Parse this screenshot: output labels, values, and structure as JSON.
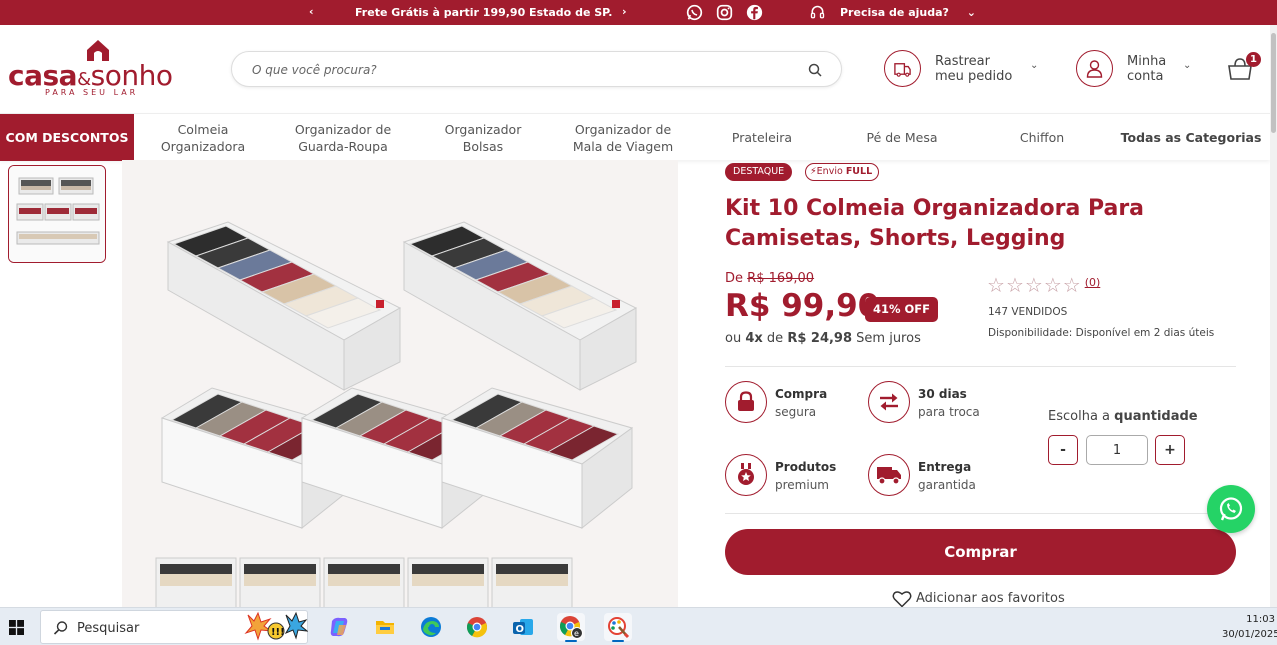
{
  "topbar": {
    "prev": "‹",
    "promo": "Frete Grátis à partir 199,90 Estado de SP.",
    "next": "›",
    "help": "Precisa de ajuda?",
    "help_caret": "⌄"
  },
  "header": {
    "logo_bold": "casa",
    "logo_amp": "&",
    "logo_light": "sonho",
    "logo_tagline": "PARA SEU LAR",
    "search_placeholder": "O que você procura?",
    "track_label": "Rastrear\nmeu pedido",
    "account_label": "Minha\nconta",
    "caret": "⌄",
    "cart_count": "1"
  },
  "nav": {
    "promo": "COM DESCONTOS",
    "items": [
      "Colmeia\nOrganizadora",
      "Organizador de\nGuarda-Roupa",
      "Organizador\nBolsas",
      "Organizador de\nMala de Viagem",
      "Prateleira",
      "Pé de Mesa",
      "Chiffon",
      "Todas as Categorias"
    ]
  },
  "product": {
    "badge_highlight": "DESTAQUE",
    "badge_shipping_prefix": "Envio",
    "badge_shipping_full": "FULL",
    "title": "Kit 10 Colmeia Organizadora Para Camisetas, Shorts, Legging",
    "old_price_prefix": "De",
    "old_price": "R$ 169,00",
    "price": "R$ 99,90",
    "discount": "41% OFF",
    "installment_prefix": "ou",
    "installment_count": "4x",
    "installment_mid": "de",
    "installment_value": "R$ 24,98",
    "installment_suffix": "Sem juros",
    "rating_stars": "☆",
    "rating_count": "(0)",
    "sold": "147 VENDIDOS",
    "availability": "Disponibilidade: Disponível em 2 dias úteis",
    "features": [
      {
        "title": "Compra",
        "subtitle": "segura",
        "icon": "lock-icon"
      },
      {
        "title": "30 dias",
        "subtitle": "para troca",
        "icon": "exchange-icon"
      },
      {
        "title": "Produtos",
        "subtitle": "premium",
        "icon": "medal-icon"
      },
      {
        "title": "Entrega",
        "subtitle": "garantida",
        "icon": "truck-icon"
      }
    ],
    "qty_label_prefix": "Escolha a",
    "qty_label_bold": "quantidade",
    "qty_minus": "-",
    "qty_value": "1",
    "qty_plus": "+",
    "buy_label": "Comprar",
    "favorite_label": "Adicionar aos favoritos",
    "accent_color": "#a11c2e"
  },
  "taskbar": {
    "search_text": "Pesquisar",
    "time": "11:03",
    "date": "30/01/2025",
    "apps": [
      "copilot-icon",
      "file-explorer-icon",
      "edge-icon",
      "chrome-icon",
      "outlook-icon",
      "chrome-profile-icon",
      "paint-icon"
    ]
  }
}
